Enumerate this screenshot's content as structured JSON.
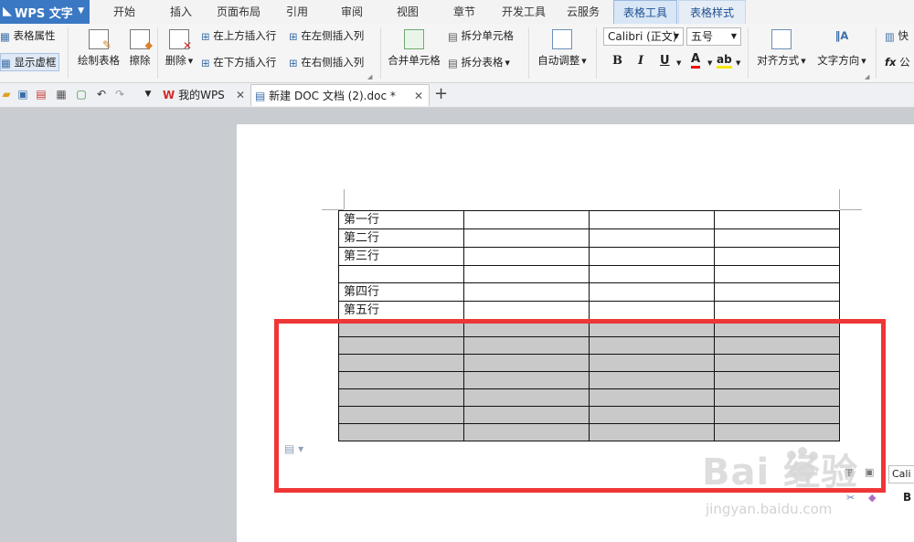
{
  "app": {
    "name": "WPS 文字"
  },
  "tabs": [
    {
      "label": "开始"
    },
    {
      "label": "插入"
    },
    {
      "label": "页面布局"
    },
    {
      "label": "引用"
    },
    {
      "label": "审阅"
    },
    {
      "label": "视图"
    },
    {
      "label": "章节"
    },
    {
      "label": "开发工具"
    },
    {
      "label": "云服务"
    },
    {
      "label": "表格工具"
    },
    {
      "label": "表格样式"
    }
  ],
  "ribbon": {
    "table_props": "表格属性",
    "show_gridlines": "显示虚框",
    "draw_table": "绘制表格",
    "eraser": "擦除",
    "delete": "删除",
    "insert_above": "在上方插入行",
    "insert_below": "在下方插入行",
    "insert_left": "在左侧插入列",
    "insert_right": "在右侧插入列",
    "merge_cells": "合并单元格",
    "split_cells": "拆分单元格",
    "split_table": "拆分表格",
    "auto_fit": "自动调整",
    "font_name": "Calibri (正文)",
    "font_size": "五号",
    "bold": "B",
    "italic": "I",
    "underline": "U",
    "font_color": "A",
    "highlight": "ab",
    "align": "对齐方式",
    "text_dir": "文字方向",
    "quick_calc": "快",
    "formula_fx": "fx",
    "formula": "公"
  },
  "doc_tabs": [
    {
      "label": "我的WPS"
    },
    {
      "label": "新建 DOC 文档 (2).doc *"
    }
  ],
  "table_rows": [
    "第一行",
    "第二行",
    "第三行",
    "",
    "第四行",
    "第五行",
    "",
    "",
    "",
    "",
    "",
    "",
    ""
  ],
  "mini_toolbar": {
    "font": "Cali",
    "bold": "B"
  },
  "watermark": {
    "brand": "Bai  经验",
    "url": "jingyan.baidu.com"
  }
}
